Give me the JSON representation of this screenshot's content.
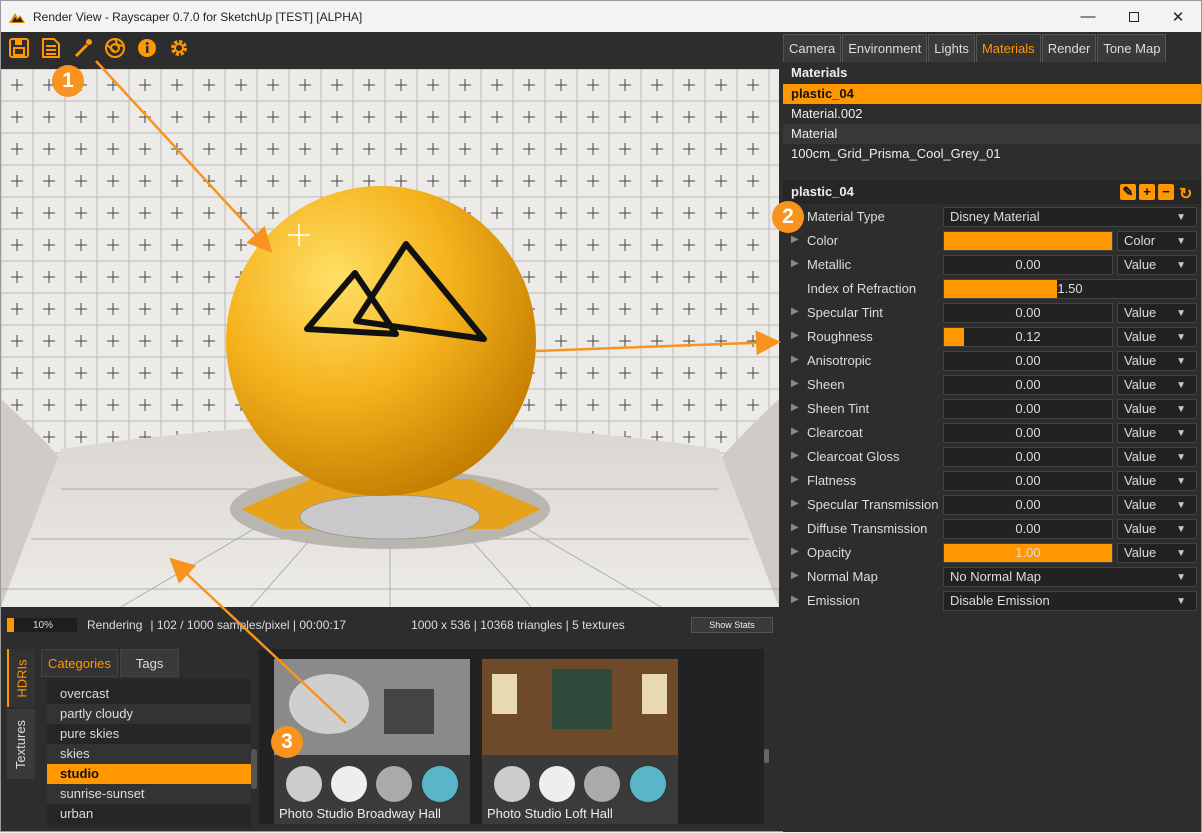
{
  "window": {
    "title": "Render View - Rayscaper 0.7.0 for SketchUp [TEST] [ALPHA]"
  },
  "toolbar": {
    "icons": [
      "save-icon",
      "notes-icon",
      "eyedropper-icon",
      "aperture-icon",
      "info-icon",
      "gear-icon"
    ]
  },
  "status": {
    "progress_pct": 10,
    "progress_label": "10%",
    "state": "Rendering",
    "samples": "| 102 / 1000 samples/pixel | 00:00:17",
    "stats": "1000 x 536 | 10368 triangles | 5 textures",
    "show_stats": "Show Stats"
  },
  "library": {
    "vtabs": [
      "HDRIs",
      "Textures"
    ],
    "tabs": [
      "Categories",
      "Tags"
    ],
    "categories": [
      "overcast",
      "partly cloudy",
      "pure skies",
      "skies",
      "studio",
      "sunrise-sunset",
      "urban"
    ],
    "selected_category": "studio",
    "hdris": [
      "Photo Studio Broadway Hall",
      "Photo Studio Loft Hall"
    ]
  },
  "panel": {
    "tabs": [
      "Camera",
      "Environment",
      "Lights",
      "Materials",
      "Render",
      "Tone Map"
    ],
    "active_tab": "Materials",
    "materials_title": "Materials",
    "materials": [
      "plastic_04",
      "Material.002",
      "Material",
      "100cm_Grid_Prisma_Cool_Grey_01"
    ],
    "selected_material": "plastic_04",
    "props_title": "plastic_04",
    "material_type_label": "Material Type",
    "material_type": "Disney Material",
    "properties": [
      {
        "label": "Color",
        "value": "",
        "fill": 1.0,
        "mode": "Color"
      },
      {
        "label": "Metallic",
        "value": "0.00",
        "fill": 0,
        "mode": "Value"
      },
      {
        "label": "Index of Refraction",
        "value": "1.50",
        "fill": 0.45,
        "mode": ""
      },
      {
        "label": "Specular Tint",
        "value": "0.00",
        "fill": 0,
        "mode": "Value"
      },
      {
        "label": "Roughness",
        "value": "0.12",
        "fill": 0.12,
        "mode": "Value"
      },
      {
        "label": "Anisotropic",
        "value": "0.00",
        "fill": 0,
        "mode": "Value"
      },
      {
        "label": "Sheen",
        "value": "0.00",
        "fill": 0,
        "mode": "Value"
      },
      {
        "label": "Sheen Tint",
        "value": "0.00",
        "fill": 0,
        "mode": "Value"
      },
      {
        "label": "Clearcoat",
        "value": "0.00",
        "fill": 0,
        "mode": "Value"
      },
      {
        "label": "Clearcoat Gloss",
        "value": "0.00",
        "fill": 0,
        "mode": "Value"
      },
      {
        "label": "Flatness",
        "value": "0.00",
        "fill": 0,
        "mode": "Value"
      },
      {
        "label": "Specular Transmission",
        "value": "0.00",
        "fill": 0,
        "mode": "Value"
      },
      {
        "label": "Diffuse Transmission",
        "value": "0.00",
        "fill": 0,
        "mode": "Value"
      },
      {
        "label": "Opacity",
        "value": "1.00",
        "fill": 1.0,
        "mode": "Value"
      }
    ],
    "normal_map_label": "Normal Map",
    "normal_map": "No Normal Map",
    "emission_label": "Emission",
    "emission": "Disable Emission"
  },
  "callouts": [
    "1",
    "2",
    "3"
  ],
  "colors": {
    "accent": "#ff9800",
    "sphere": "#f5b21c",
    "panel_bg": "#2d2d2d"
  }
}
